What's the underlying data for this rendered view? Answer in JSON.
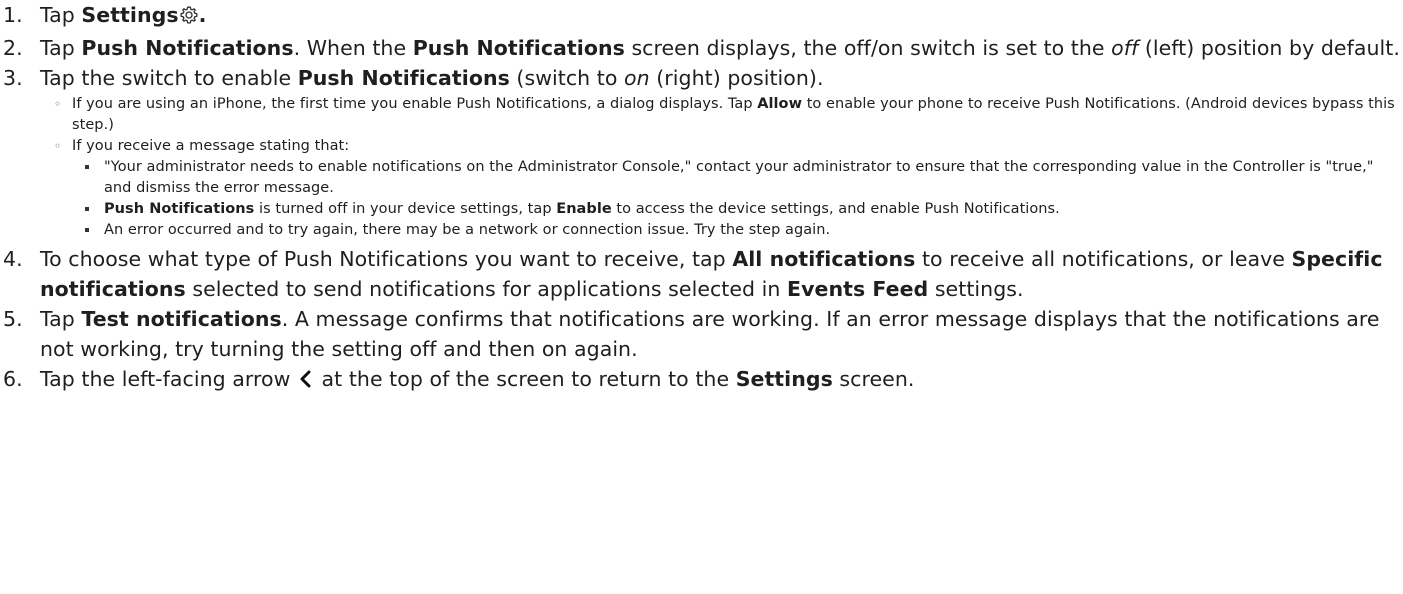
{
  "steps": [
    {
      "num": "1.",
      "t1": "Tap ",
      "b1": "Settings",
      "icon": "gear-icon",
      "t2": "."
    },
    {
      "num": "2.",
      "t1": "Tap ",
      "b1": "Push Notifications",
      "t2": ". When the ",
      "b2": "Push Notifications",
      "t3": " screen displays, the off/on switch is set to the ",
      "i1": "off",
      "t4": " (left) position by default."
    },
    {
      "num": "3.",
      "t1": "Tap the switch to enable ",
      "b1": "Push Notifications",
      "t2": " (switch to ",
      "i1": "on",
      "t3": " (right) position).",
      "sub": [
        {
          "t1": "If you are using an iPhone, the first time you enable Push Notifications, a dialog displays. Tap ",
          "b1": "Allow",
          "t2": " to enable your phone to receive Push Notifications. (Android devices bypass this step.)"
        },
        {
          "t1": "If you receive a message stating that:",
          "subsub": [
            {
              "t1": "\"Your administrator needs to enable notifications on the Administrator Console,\" contact your administrator to ensure that the corresponding value in the Controller is \"true,\" and dismiss the error message."
            },
            {
              "b1": "Push Notifications",
              "t1": " is turned off in your device settings, tap ",
              "b2": "Enable",
              "t2": " to access the device settings, and enable Push Notifications."
            },
            {
              "t1": "An error occurred and to try again, there may be a network or connection issue. Try the step again."
            }
          ]
        }
      ]
    },
    {
      "num": "4.",
      "t1": "To choose what type of Push Notifications you want to receive, tap ",
      "b1": "All notifications",
      "t2": " to receive all notifications, or leave ",
      "b2": "Specific notifications",
      "t3": " selected to send notifications for applications selected in ",
      "b3": "Events Feed",
      "t4": " settings."
    },
    {
      "num": "5.",
      "t1": "Tap ",
      "b1": "Test notifications",
      "t2": ". A message confirms that notifications are working. If an error message displays that the notifications are not working, try turning the setting off and then on again."
    },
    {
      "num": "6.",
      "t1": "Tap the left-facing arrow ",
      "icon": "chevron-left-icon",
      "t2": " at the top of the screen to return to the ",
      "b1": "Settings",
      "t3": " screen."
    }
  ]
}
